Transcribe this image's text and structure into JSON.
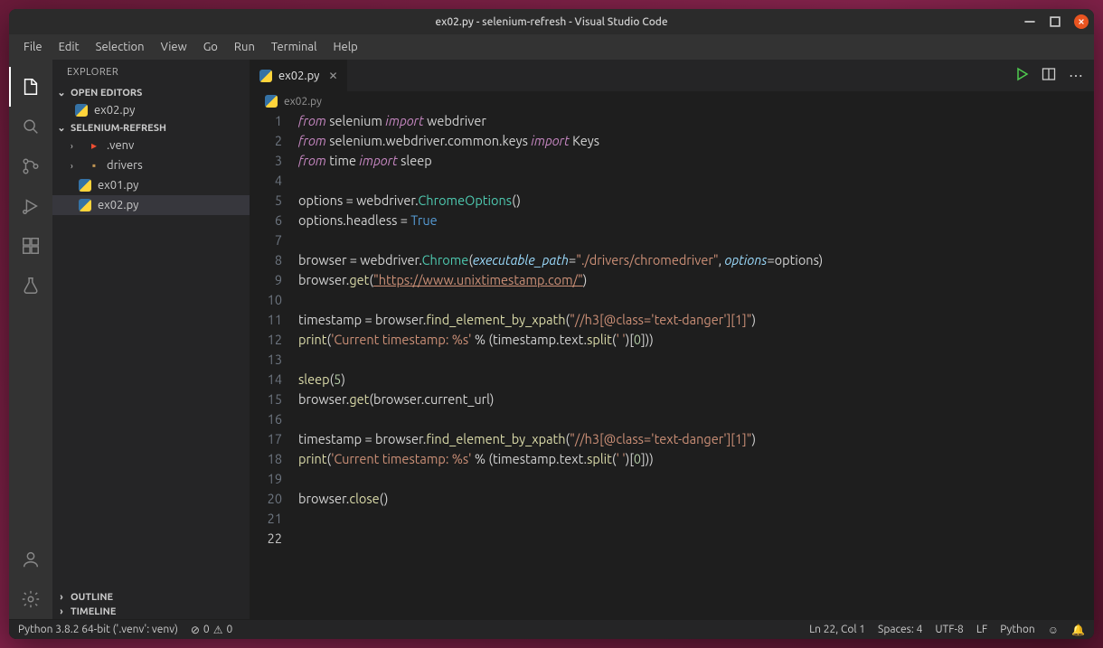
{
  "title": "ex02.py - selenium-refresh - Visual Studio Code",
  "menu": [
    "File",
    "Edit",
    "Selection",
    "View",
    "Go",
    "Run",
    "Terminal",
    "Help"
  ],
  "sidebar": {
    "title": "EXPLORER",
    "open_editors": "OPEN EDITORS",
    "project": "SELENIUM-REFRESH",
    "items": {
      "open_file": "ex02.py",
      "venv": ".venv",
      "drivers": "drivers",
      "ex01": "ex01.py",
      "ex02": "ex02.py"
    },
    "outline": "OUTLINE",
    "timeline": "TIMELINE"
  },
  "tab": {
    "label": "ex02.py"
  },
  "breadcrumb": "ex02.py",
  "code": {
    "lines": 22,
    "l1": {
      "a": "from",
      "b": " selenium ",
      "c": "import",
      "d": " webdriver"
    },
    "l2": {
      "a": "from",
      "b": " selenium.webdriver.common.keys ",
      "c": "import",
      "d": " Keys"
    },
    "l3": {
      "a": "from",
      "b": " time ",
      "c": "import",
      "d": " sleep"
    },
    "l5": {
      "a": "options ",
      "b": "=",
      "c": " webdriver.",
      "d": "ChromeOptions",
      "e": "()"
    },
    "l6": {
      "a": "options.headless ",
      "b": "=",
      "c": " ",
      "d": "True"
    },
    "l8": {
      "a": "browser ",
      "b": "=",
      "c": " webdriver.",
      "d": "Chrome",
      "e": "(",
      "f": "executable_path",
      "g": "=",
      "h": "\"./drivers/chromedriver\"",
      "i": ", ",
      "j": "options",
      "k": "=",
      "l": "options)"
    },
    "l9": {
      "a": "browser.",
      "b": "get",
      "c": "(",
      "d": "\"https://www.unixtimestamp.com/\"",
      "e": ")"
    },
    "l11": {
      "a": "timestamp ",
      "b": "=",
      "c": " browser.",
      "d": "find_element_by_xpath",
      "e": "(",
      "f": "\"//h3[@class='text-danger'][1]\"",
      "g": ")"
    },
    "l12": {
      "a": "print",
      "b": "(",
      "c": "'Current timestamp: %s'",
      "d": " % (timestamp.text.",
      "e": "split",
      "f": "(",
      "g": "' '",
      "h": ")[",
      "i": "0",
      "j": "]))"
    },
    "l14": {
      "a": "sleep",
      "b": "(",
      "c": "5",
      "d": ")"
    },
    "l15": {
      "a": "browser.",
      "b": "get",
      "c": "(browser.current_url)"
    },
    "l17": {
      "a": "timestamp ",
      "b": "=",
      "c": " browser.",
      "d": "find_element_by_xpath",
      "e": "(",
      "f": "\"//h3[@class='text-danger'][1]\"",
      "g": ")"
    },
    "l18": {
      "a": "print",
      "b": "(",
      "c": "'Current timestamp: %s'",
      "d": " % (timestamp.text.",
      "e": "split",
      "f": "(",
      "g": "' '",
      "h": ")[",
      "i": "0",
      "j": "]))"
    },
    "l20": {
      "a": "browser.",
      "b": "close",
      "c": "()"
    }
  },
  "status": {
    "python": "Python 3.8.2 64-bit ('.venv': venv)",
    "problems": "0",
    "warnings": "0",
    "pos": "Ln 22, Col 1",
    "spaces": "Spaces: 4",
    "enc": "UTF-8",
    "eol": "LF",
    "lang": "Python"
  }
}
